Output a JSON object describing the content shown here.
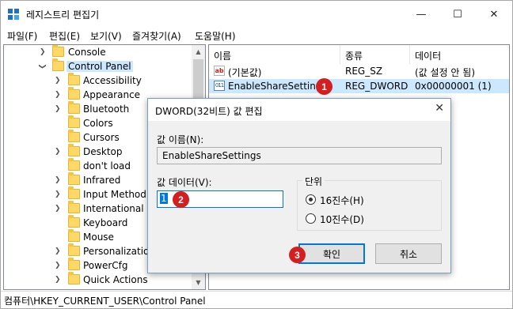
{
  "window": {
    "title": "레지스트리 편집기",
    "minimize_glyph": "—",
    "maximize_glyph": "☐",
    "close_glyph": "✕"
  },
  "menu": [
    "파일(F)",
    "편집(E)",
    "보기(V)",
    "즐겨찾기(A)",
    "도움말(H)"
  ],
  "tree": {
    "console": "Console",
    "control_panel": "Control Panel",
    "children": [
      "Accessibility",
      "Appearance",
      "Bluetooth",
      "Colors",
      "Cursors",
      "Desktop",
      "don't load",
      "Infrared",
      "Input Method",
      "International",
      "Keyboard",
      "Mouse",
      "Personalization",
      "PowerCfg",
      "Quick Actions"
    ]
  },
  "list": {
    "headers": {
      "name": "이름",
      "type": "종류",
      "data": "데이터"
    },
    "rows": [
      {
        "icon": "ab",
        "name": "(기본값)",
        "type": "REG_SZ",
        "data": "(값 설정 안 됨)"
      },
      {
        "icon": "011",
        "name": "EnableShareSettings",
        "type": "REG_DWORD",
        "data": "0x00000001 (1)"
      }
    ]
  },
  "badges": {
    "b1": "1",
    "b2": "2",
    "b3": "3"
  },
  "dialog": {
    "title": "DWORD(32비트) 값 편집",
    "close_glyph": "✕",
    "value_name_label": "값 이름(N):",
    "value_name": "EnableShareSettings",
    "value_data_label": "값 데이터(V):",
    "value_data": "1",
    "base_group_title": "단위",
    "radio_hex": "16진수(H)",
    "radio_dec": "10진수(D)",
    "ok": "확인",
    "cancel": "취소"
  },
  "status": {
    "path": "컴퓨터\\HKEY_CURRENT_USER\\Control Panel"
  },
  "colors": {
    "accent": "#0078d7",
    "selection": "#cce8ff",
    "badge": "#d31f1f",
    "folder": "#ffd866"
  }
}
